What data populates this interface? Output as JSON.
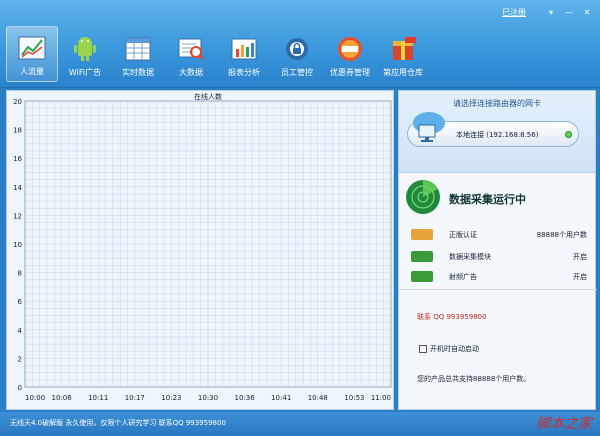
{
  "window": {
    "register_link": "已注册",
    "menu_btn": "▾",
    "min_btn": "—",
    "close_btn": "✕"
  },
  "toolbar": [
    {
      "label": "人流量",
      "icon": "traffic-chart-icon",
      "active": true
    },
    {
      "label": "WiFi广告",
      "icon": "android-robot-icon",
      "active": false
    },
    {
      "label": "实时数据",
      "icon": "spreadsheet-icon",
      "active": false
    },
    {
      "label": "大数据",
      "icon": "magnifier-data-icon",
      "active": false
    },
    {
      "label": "报表分析",
      "icon": "report-chart-icon",
      "active": false
    },
    {
      "label": "员工管控",
      "icon": "lock-settings-icon",
      "active": false
    },
    {
      "label": "优惠券管理",
      "icon": "coupon-icon",
      "active": false
    },
    {
      "label": "第应用仓库",
      "icon": "app-store-icon",
      "active": false
    }
  ],
  "chart_data": {
    "type": "line",
    "title": "在线人数",
    "x": [
      "10:00",
      "10:06",
      "10:11",
      "10:17",
      "10:23",
      "10:30",
      "10:36",
      "10:41",
      "10:48",
      "10:53",
      "11:00"
    ],
    "series": [],
    "ylim": [
      0,
      20
    ],
    "yticks": [
      0,
      2,
      4,
      6,
      8,
      10,
      12,
      14,
      16,
      18,
      20
    ],
    "grid": true,
    "colors": {
      "grid": "#c4d6e8",
      "axis": "#8fa9c4",
      "bg": "#eef5fc"
    }
  },
  "right_panel": {
    "select_title": "请选择连接路由器的网卡",
    "network_label": "本地连接 (192.168.8.56)",
    "status_title": "数据采集运行中",
    "rows": [
      {
        "name": "正版认证",
        "value": "88888个用户数",
        "color": "#e8a23a"
      },
      {
        "name": "数据采集模块",
        "value": "开启",
        "color": "#3a9a3a"
      },
      {
        "name": "射频广告",
        "value": "开启",
        "color": "#3a9a3a"
      }
    ],
    "contact": "联系 QQ 993959800",
    "autostart_label": "开机时自动启动",
    "support_text": "您的产品总共支持88888个用户数。"
  },
  "statusbar": {
    "text": "无线天4.0破解版    永久使用，仅限个人研究学习  联系QQ  993959800",
    "watermark": "脚本之家"
  }
}
